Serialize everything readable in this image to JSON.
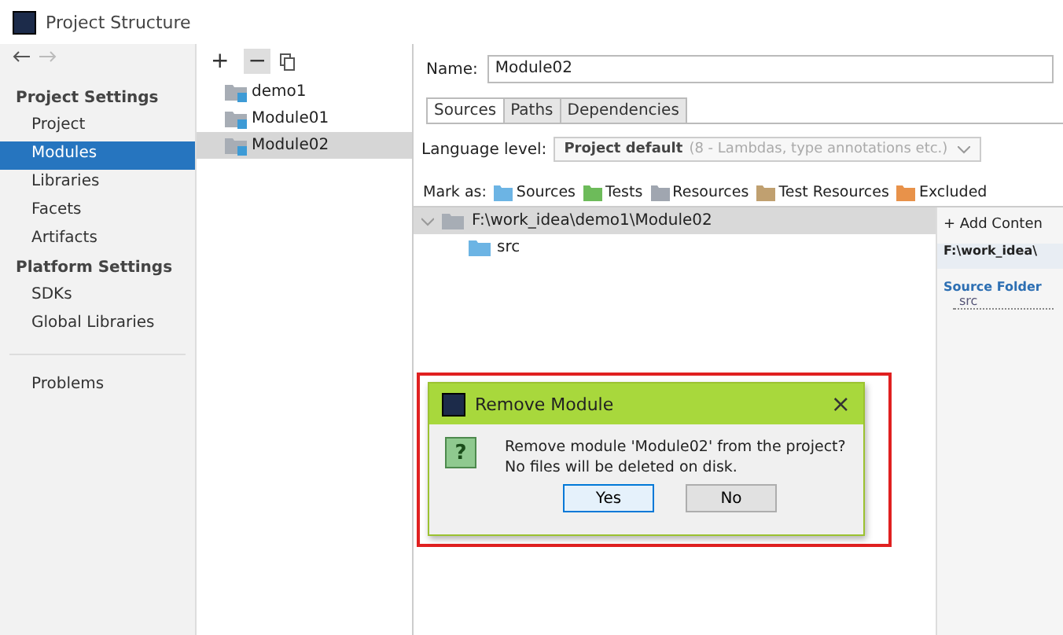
{
  "window": {
    "title": "Project Structure"
  },
  "sidebar": {
    "items": [
      {
        "kind": "header",
        "label": "Project Settings"
      },
      {
        "kind": "item",
        "label": "Project",
        "selected": false
      },
      {
        "kind": "item",
        "label": "Modules",
        "selected": true
      },
      {
        "kind": "item",
        "label": "Libraries",
        "selected": false
      },
      {
        "kind": "item",
        "label": "Facets",
        "selected": false
      },
      {
        "kind": "item",
        "label": "Artifacts",
        "selected": false
      },
      {
        "kind": "header",
        "label": "Platform Settings"
      },
      {
        "kind": "item",
        "label": "SDKs",
        "selected": false
      },
      {
        "kind": "item",
        "label": "Global Libraries",
        "selected": false
      },
      {
        "kind": "divider"
      },
      {
        "kind": "item",
        "label": "Problems",
        "selected": false
      }
    ]
  },
  "modules": {
    "toolbar": [
      "+",
      "−"
    ],
    "items": [
      {
        "label": "demo1",
        "selected": false
      },
      {
        "label": "Module01",
        "selected": false
      },
      {
        "label": "Module02",
        "selected": true
      }
    ]
  },
  "editor": {
    "name_label": "Name:",
    "name_value": "Module02",
    "tabs": [
      {
        "label": "Sources",
        "selected": true
      },
      {
        "label": "Paths",
        "selected": false
      },
      {
        "label": "Dependencies",
        "selected": false
      }
    ],
    "language_label": "Language level:",
    "language_value": "Project default",
    "language_hint": "(8 - Lambdas, type annotations etc.)",
    "mark_label": "Mark as:",
    "mark_items": [
      {
        "label": "Sources",
        "color": "#6cb4e4"
      },
      {
        "label": "Tests",
        "color": "#6dbb5a"
      },
      {
        "label": "Resources",
        "color": "#a0a6b0"
      },
      {
        "label": "Test Resources",
        "color": "#c0a070"
      },
      {
        "label": "Excluded",
        "color": "#e8924a"
      }
    ],
    "tree": {
      "label": "F:\\work_idea\\demo1\\Module02",
      "expanded": true,
      "selected": true,
      "children": [
        {
          "label": "src"
        }
      ]
    },
    "roots": {
      "add": "+ Add Conten",
      "path": "F:\\work_idea\\",
      "folder_title": "Source Folder",
      "folder": "src"
    }
  },
  "dialog": {
    "title": "Remove Module",
    "close": "×",
    "icon": "?",
    "message": "Remove module 'Module02' from the project?",
    "note": "No files will be deleted on disk.",
    "buttons": [
      {
        "label": "Yes",
        "selected": true
      },
      {
        "label": "No",
        "selected": false
      }
    ]
  }
}
